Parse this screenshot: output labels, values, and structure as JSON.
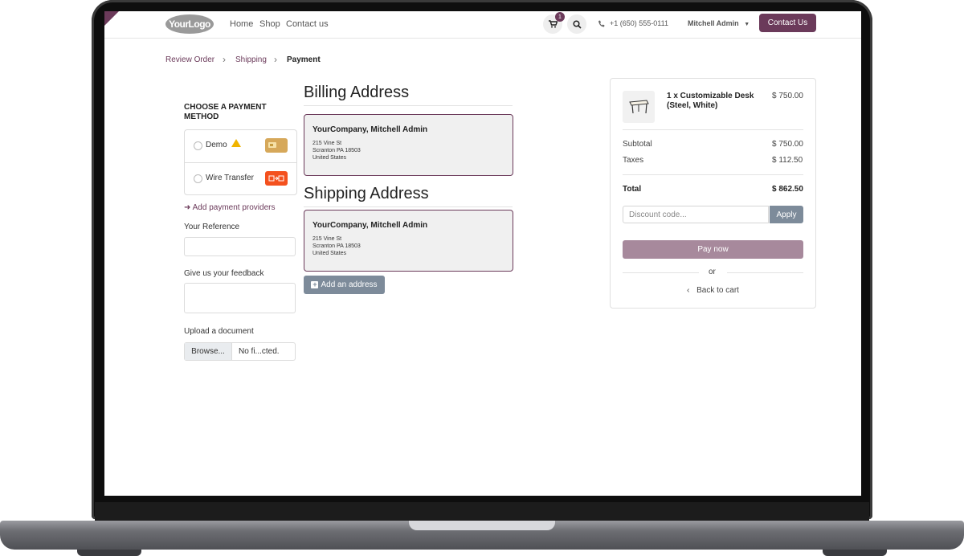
{
  "header": {
    "logo_text": "YourLogo",
    "nav": [
      "Home",
      "Shop",
      "Contact us"
    ],
    "cart_count": "1",
    "phone": "+1 (650) 555-0111",
    "user": "Mitchell Admin",
    "contact_button": "Contact Us"
  },
  "breadcrumb": {
    "items": [
      "Review Order",
      "Shipping"
    ],
    "active": "Payment"
  },
  "payment": {
    "title": "CHOOSE A PAYMENT METHOD",
    "methods": [
      {
        "label": "Demo",
        "icon": "card-icon",
        "warning": true
      },
      {
        "label": "Wire Transfer",
        "icon": "bank-transfer-icon",
        "warning": false
      }
    ],
    "add_providers": "Add payment providers",
    "reference_label": "Your Reference",
    "feedback_label": "Give us your feedback",
    "upload_label": "Upload a document",
    "browse_label": "Browse...",
    "file_value": "No fi...cted."
  },
  "billing": {
    "title": "Billing Address",
    "name": "YourCompany, Mitchell Admin",
    "lines": [
      "215 Vine St",
      "Scranton PA 18503",
      "United States"
    ]
  },
  "shipping": {
    "title": "Shipping Address",
    "name": "YourCompany, Mitchell Admin",
    "lines": [
      "215 Vine St",
      "Scranton PA 18503",
      "United States"
    ],
    "add_button": "Add an address"
  },
  "summary": {
    "product": "1 x Customizable Desk (Steel, White)",
    "product_price": "$ 750.00",
    "subtotal_label": "Subtotal",
    "subtotal": "$ 750.00",
    "taxes_label": "Taxes",
    "taxes": "$ 112.50",
    "total_label": "Total",
    "total": "$ 862.50",
    "discount_placeholder": "Discount code...",
    "apply": "Apply",
    "pay_now": "Pay now",
    "or": "or",
    "back_to_cart": "Back to cart"
  },
  "colors": {
    "primary": "#6b3a5a",
    "secondary": "#7d8b9a",
    "pay_button": "#a7899c"
  }
}
